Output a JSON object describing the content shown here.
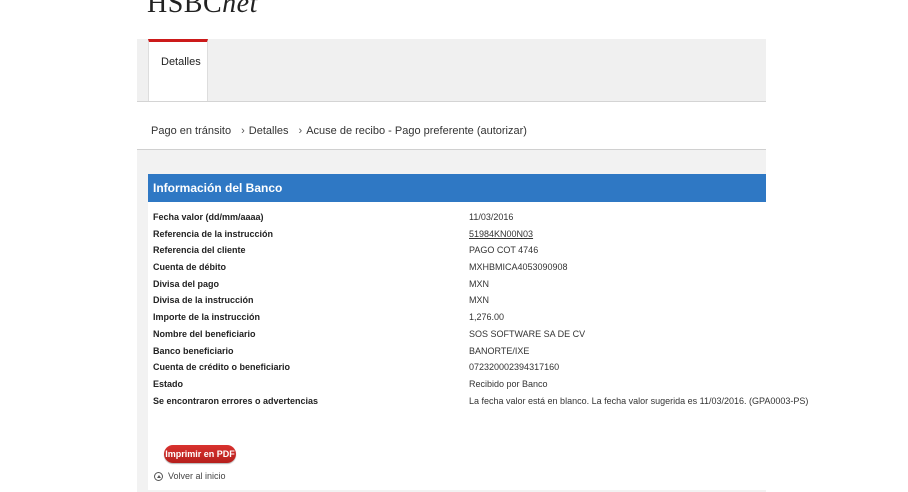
{
  "brand": {
    "bold": "HSBC",
    "italic": "net"
  },
  "tabs": [
    {
      "label": "Detalles"
    }
  ],
  "breadcrumb": {
    "items": [
      "Pago en tránsito",
      "Detalles",
      "Acuse de recibo - Pago preferente (autorizar)"
    ],
    "separator": "›"
  },
  "panel": {
    "title": "Información del Banco",
    "rows": [
      {
        "label": "Fecha valor (dd/mm/aaaa)",
        "value": "11/03/2016"
      },
      {
        "label": "Referencia de la instrucción",
        "value": "51984KN00N03"
      },
      {
        "label": "Referencia del cliente",
        "value": "PAGO COT 4746"
      },
      {
        "label": "Cuenta de débito",
        "value": "MXHBMICA4053090908"
      },
      {
        "label": "Divisa del pago",
        "value": "MXN"
      },
      {
        "label": "Divisa de la instrucción",
        "value": "MXN"
      },
      {
        "label": "Importe de la instrucción",
        "value": "1,276.00"
      },
      {
        "label": "Nombre del beneficiario",
        "value": "SOS SOFTWARE SA DE CV"
      },
      {
        "label": "Banco beneficiario",
        "value": "BANORTE/IXE"
      },
      {
        "label": "Cuenta de crédito o beneficiario",
        "value": "072320002394317160"
      },
      {
        "label": "Estado",
        "value": "Recibido por Banco"
      },
      {
        "label": "Se encontraron errores o advertencias",
        "value": "La fecha valor está en blanco. La fecha valor sugerida es 11/03/2016. (GPA0003-PS)"
      }
    ],
    "pdf_button": "Imprimir en PDF",
    "back_link": "Volver al inicio"
  },
  "colors": {
    "header_blue": "#2f78c4",
    "tab_accent": "#cc1a1a",
    "pdf_red": "#c62a27"
  },
  "icons": {
    "back": "chevron-up-circle-icon"
  }
}
